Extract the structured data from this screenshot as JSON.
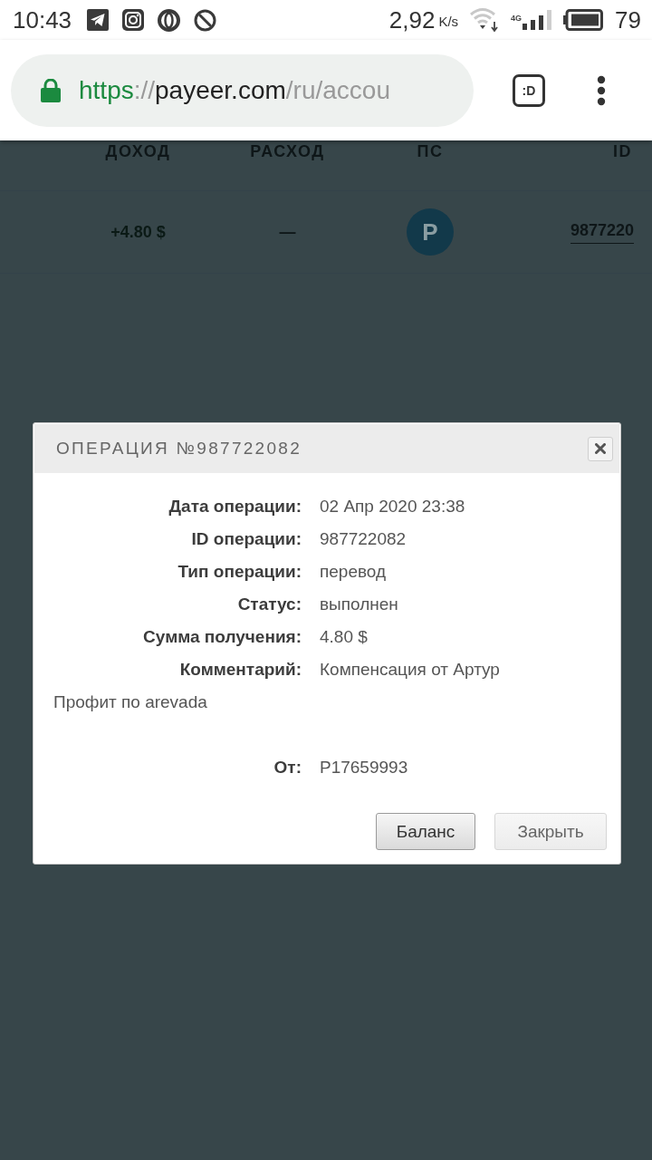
{
  "status_bar": {
    "time": "10:43",
    "speed": "2,92",
    "speed_unit": "K/s",
    "network_type": "4G",
    "battery": "79"
  },
  "browser": {
    "url_scheme": "https",
    "url_separator": "://",
    "url_host": "payeer.com",
    "url_path": "/ru/accou",
    "tabs_label": ":D"
  },
  "table": {
    "columns": [
      "ДОХОД",
      "РАСХОД",
      "ПС",
      "ID"
    ],
    "rows": [
      {
        "income": "+4.80 $",
        "expense": "—",
        "ps_logo": "P",
        "id": "9877220"
      }
    ]
  },
  "dialog": {
    "title": "ОПЕРАЦИЯ №987722082",
    "details": [
      {
        "label": "Дата операции:",
        "value": "02 Апр 2020 23:38"
      },
      {
        "label": "ID операции:",
        "value": "987722082"
      },
      {
        "label": "Тип операции:",
        "value": "перевод"
      },
      {
        "label": "Статус:",
        "value": "выполнен"
      },
      {
        "label": "Сумма получения:",
        "value": "4.80 $"
      },
      {
        "label": "Комментарий:",
        "value": "Компенсация от Артур"
      }
    ],
    "note": "Профит по arevada",
    "sender": {
      "label": "От:",
      "value": "P17659993"
    },
    "buttons": [
      {
        "label": "Баланс",
        "kind": "default"
      },
      {
        "label": "Закрыть",
        "kind": "plain"
      }
    ]
  }
}
